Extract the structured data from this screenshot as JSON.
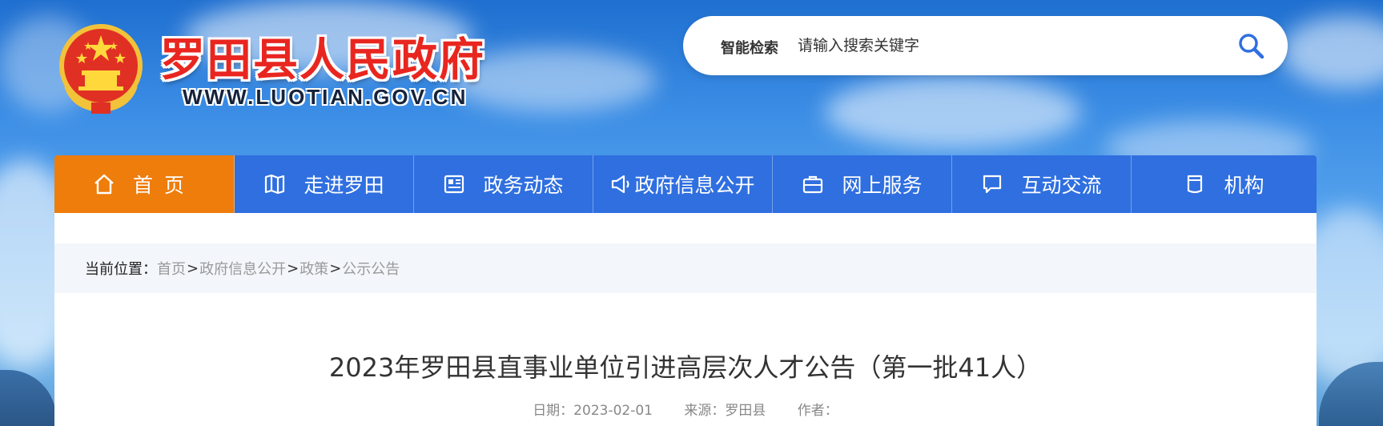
{
  "header": {
    "site_title": "罗田县人民政府",
    "site_url": "WWW.LUOTIAN.GOV.CN"
  },
  "search": {
    "label": "智能检索",
    "placeholder": "请输入搜索关键字"
  },
  "nav": {
    "items": [
      {
        "label": "首页",
        "icon": "home-icon",
        "active": true
      },
      {
        "label": "走进罗田",
        "icon": "map-icon"
      },
      {
        "label": "政务动态",
        "icon": "news-icon"
      },
      {
        "label": "政府信息公开",
        "icon": "megaphone-icon"
      },
      {
        "label": "网上服务",
        "icon": "briefcase-icon"
      },
      {
        "label": "互动交流",
        "icon": "chat-icon"
      },
      {
        "label": "机构",
        "icon": "cup-icon"
      }
    ]
  },
  "breadcrumb": {
    "prefix": "当前位置：",
    "items": [
      "首页",
      "政府信息公开",
      "政策",
      "公示公告"
    ],
    "separator": ">"
  },
  "article": {
    "title": "2023年罗田县直事业单位引进高层次人才公告（第一批41人）",
    "date": "日期：2023-02-01",
    "source": "来源：罗田县",
    "author": "作者："
  },
  "colors": {
    "nav_blue": "#2f6fe0",
    "nav_active": "#ee7d0c",
    "title_red": "#e8261f"
  }
}
